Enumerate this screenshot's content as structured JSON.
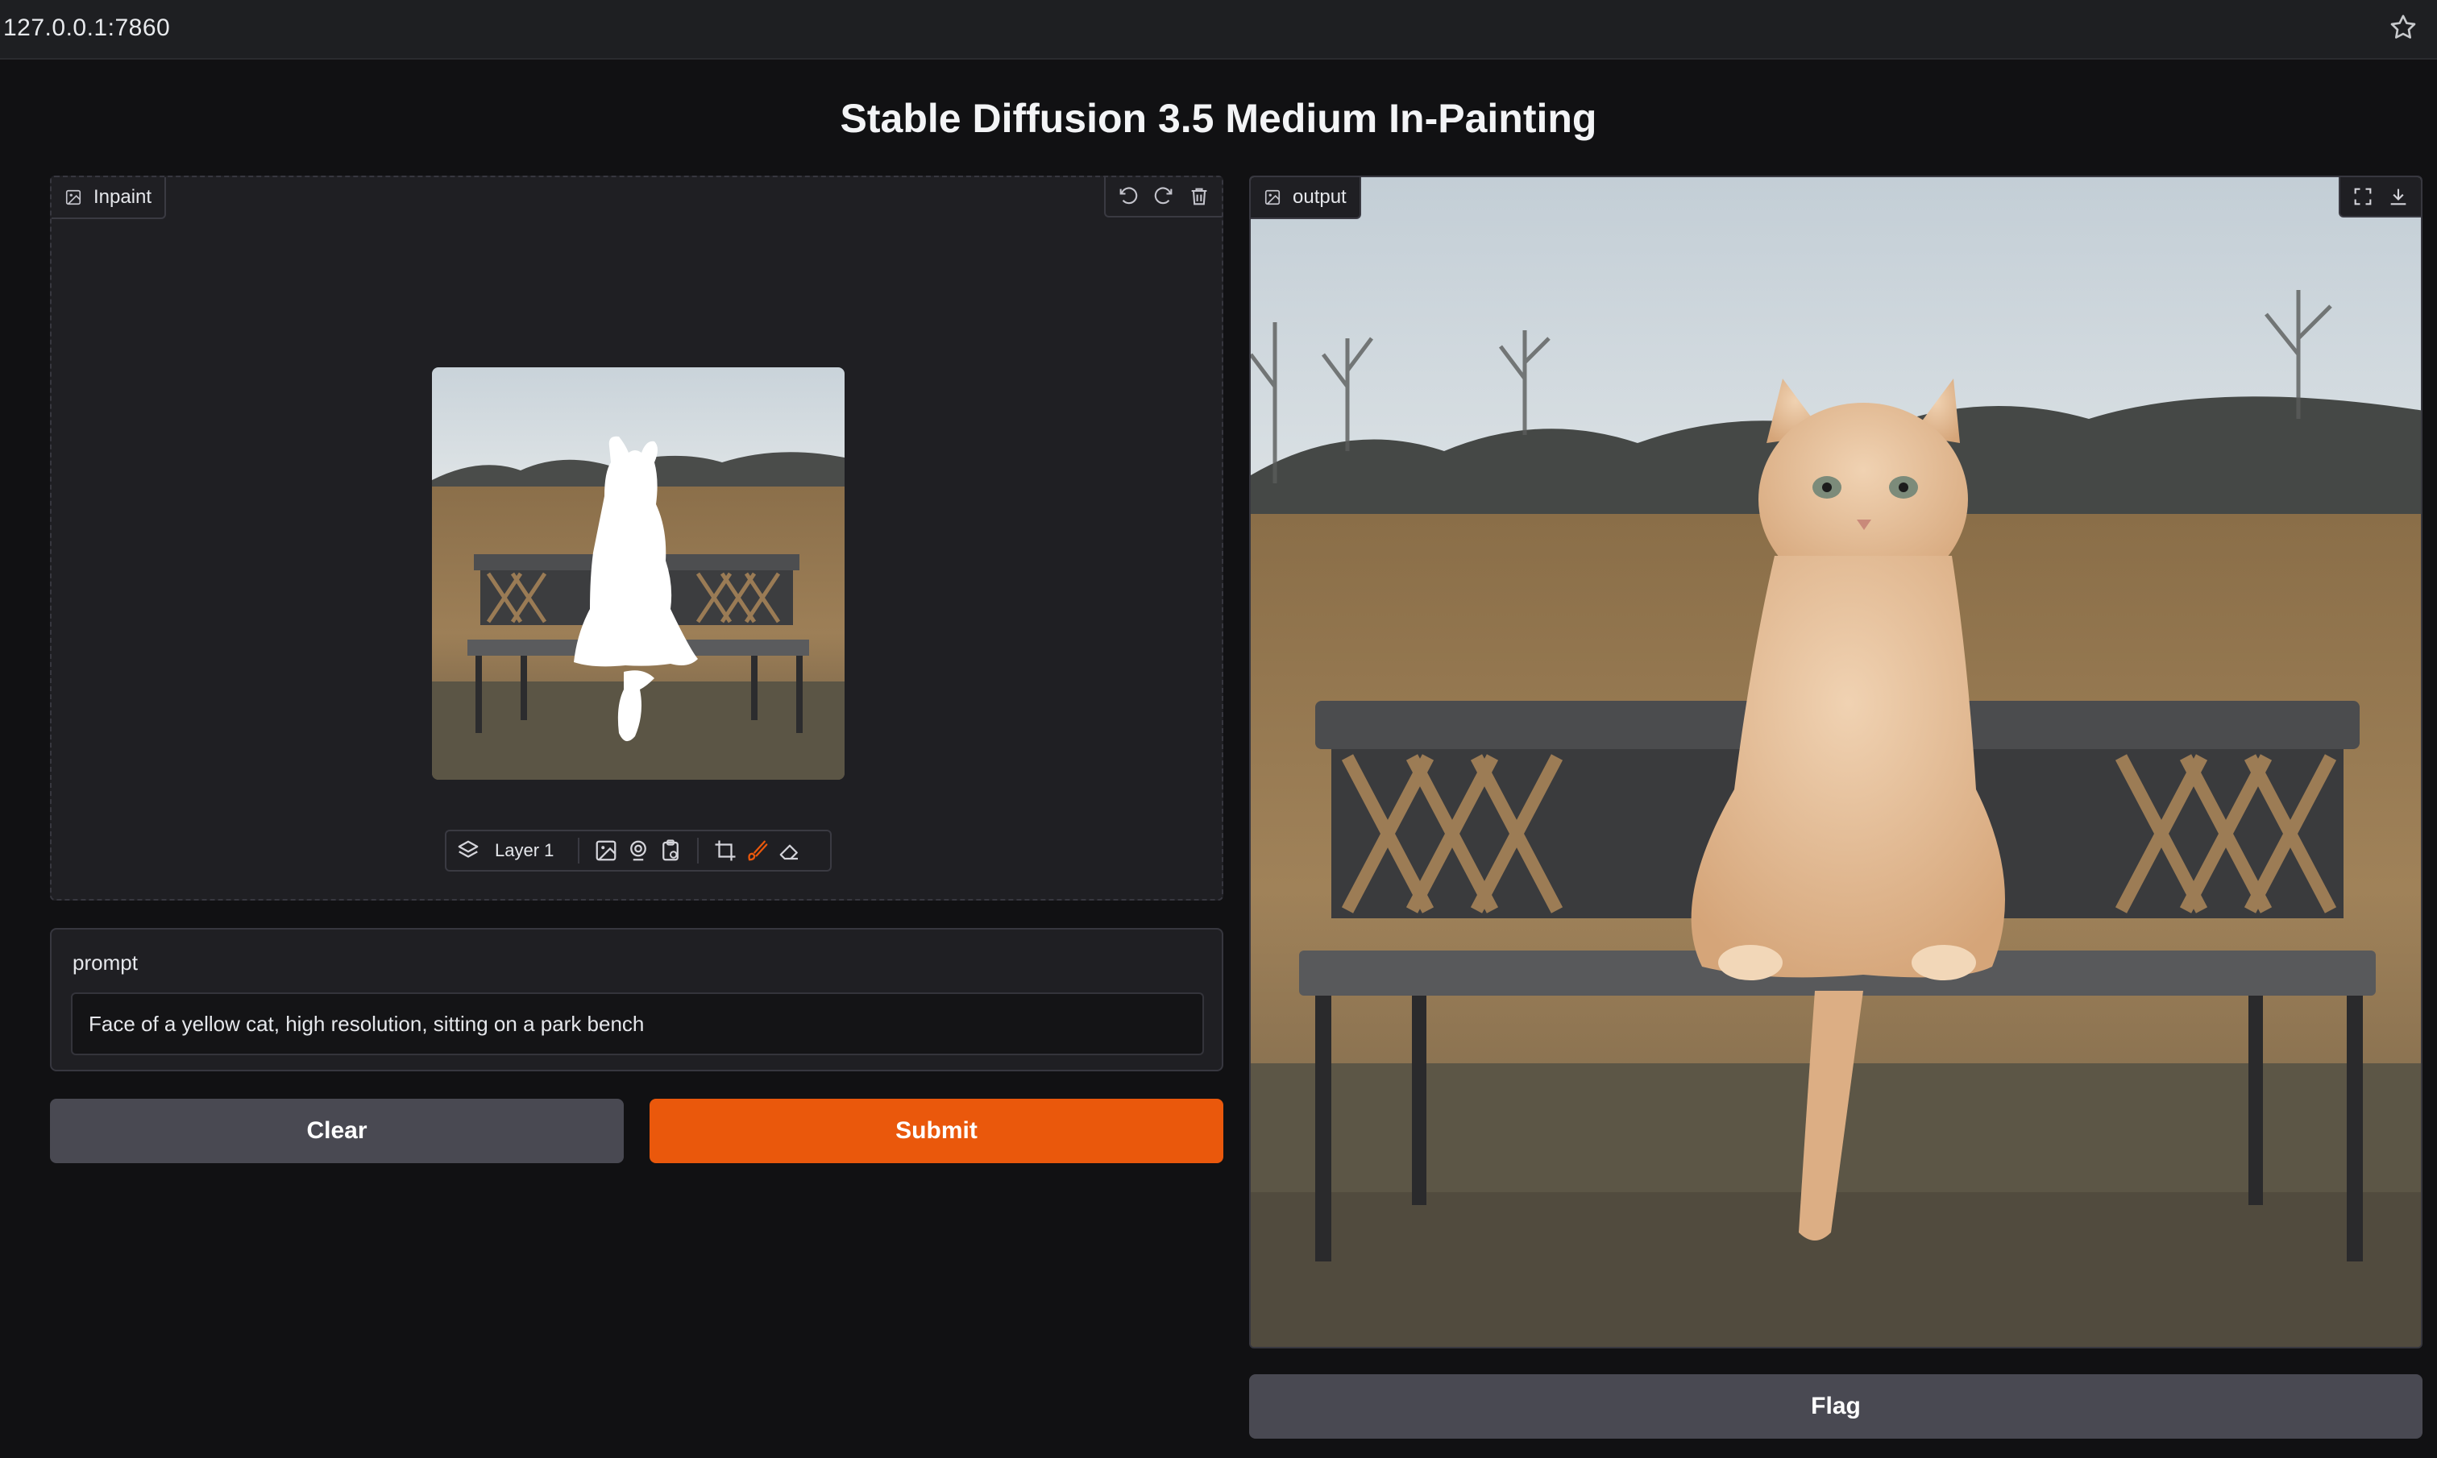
{
  "browser": {
    "url": "127.0.0.1:7860"
  },
  "app": {
    "title": "Stable Diffusion 3.5 Medium In-Painting"
  },
  "inpaint": {
    "label": "Inpaint",
    "tools": [
      "undo-icon",
      "redo-icon",
      "trash-icon"
    ],
    "layer_label": "Layer 1",
    "layer_tools": [
      "layers-icon",
      "image-upload-icon",
      "webcam-icon",
      "paste-icon",
      "crop-icon",
      "brush-icon",
      "eraser-icon"
    ]
  },
  "prompt": {
    "label": "prompt",
    "value": "Face of a yellow cat, high resolution, sitting on a park bench"
  },
  "buttons": {
    "clear": "Clear",
    "submit": "Submit",
    "flag": "Flag"
  },
  "output": {
    "label": "output",
    "tools": [
      "fullscreen-icon",
      "download-icon"
    ]
  },
  "colors": {
    "accent": "#ea580c",
    "secondary_button": "#494952",
    "panel": "#1f1f23",
    "background": "#111113"
  }
}
